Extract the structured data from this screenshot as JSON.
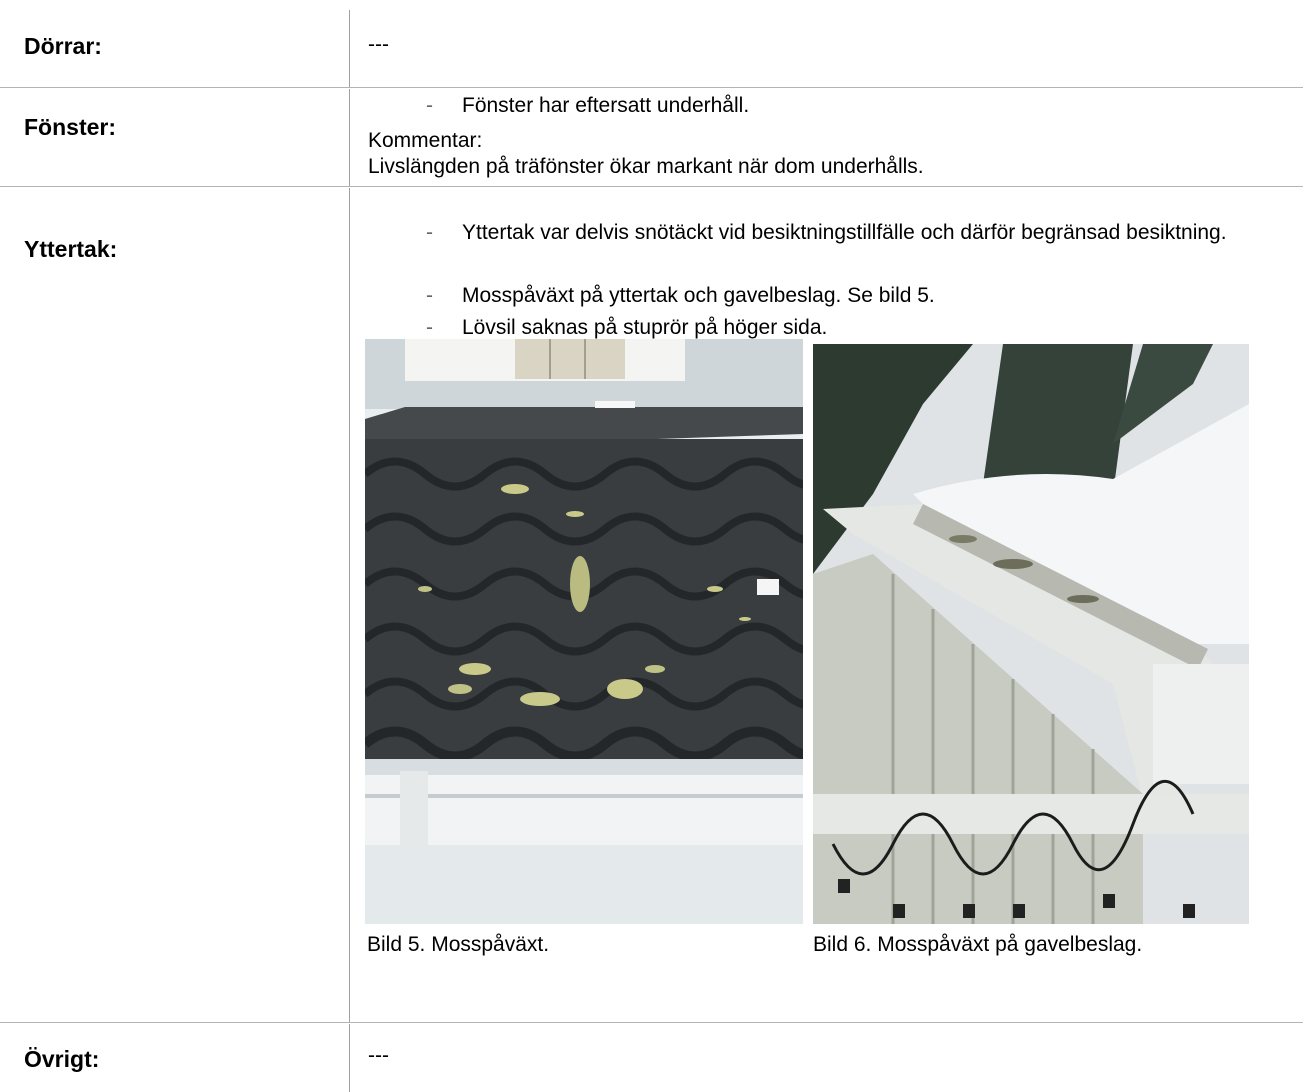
{
  "rows": {
    "dorrar": {
      "label": "Dörrar:",
      "value": "---"
    },
    "fonster": {
      "label": "Fönster:",
      "bullet": "Fönster har eftersatt underhåll.",
      "comment_label": "Kommentar:",
      "comment": "Livslängden på träfönster ökar markant när dom underhålls."
    },
    "yttertak": {
      "label": "Yttertak:",
      "bullets": [
        "Yttertak var delvis snötäckt vid besiktningstillfälle och därför begränsad besiktning.",
        "Mosspåväxt på yttertak och gavelbeslag. Se bild 5.",
        "Lövsil saknas på stuprör på höger sida."
      ],
      "bullet_marker": "-",
      "images": [
        {
          "caption": "Bild 5. Mosspåväxt."
        },
        {
          "caption": "Bild 6. Mosspåväxt på gavelbeslag."
        }
      ]
    },
    "ovrigt": {
      "label": "Övrigt:",
      "value": "---"
    }
  },
  "colors": {
    "rule": "#b4b4b4",
    "roof_tile": "#3a3d3f",
    "moss": "#c9c98a",
    "snow": "#f4f6f8",
    "sky": "#dfe3e6",
    "trees": "#2c3a30"
  }
}
